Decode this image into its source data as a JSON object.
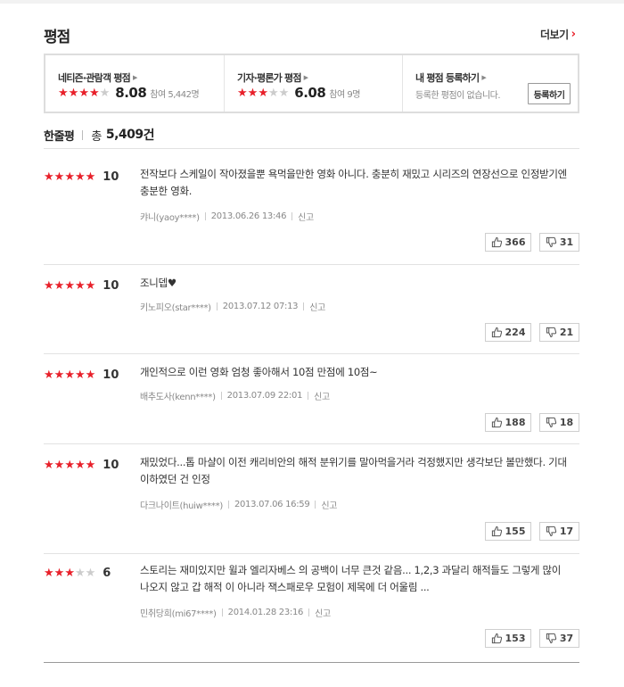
{
  "section": {
    "title": "평점",
    "more_label": "더보기"
  },
  "rating_box": {
    "netizen": {
      "label": "네티즌·관람객 평점",
      "stars": 4,
      "score": "8.08",
      "participants": "참여 5,442명"
    },
    "critic": {
      "label": "기자·평론가 평점",
      "stars": 3,
      "score": "6.08",
      "participants": "참여 9명"
    },
    "mine": {
      "label": "내 평점 등록하기",
      "empty_text": "등록한 평점이 없습니다.",
      "register_label": "등록하기"
    }
  },
  "oneline": {
    "title": "한줄평",
    "total_label": "총",
    "total_count": "5,409",
    "total_unit": "건"
  },
  "reviews": [
    {
      "stars": 5,
      "score": "10",
      "text": "전작보다 스케일이 작아졌을뿐 욕먹을만한 영화 아니다. 충분히 재밌고 시리즈의 연장선으로 인정받기엔 충분한 영화.",
      "author": "캬니(yaoy****)",
      "date": "2013.06.26 13:46",
      "report": "신고",
      "likes": "366",
      "dislikes": "31"
    },
    {
      "stars": 5,
      "score": "10",
      "text": "조니뎁♥",
      "author": "키노피오(star****)",
      "date": "2013.07.12 07:13",
      "report": "신고",
      "likes": "224",
      "dislikes": "21"
    },
    {
      "stars": 5,
      "score": "10",
      "text": "개인적으로 이런 영화 엄청 좋아해서 10점 만점에 10점~",
      "author": "배추도사(kenn****)",
      "date": "2013.07.09 22:01",
      "report": "신고",
      "likes": "188",
      "dislikes": "18"
    },
    {
      "stars": 5,
      "score": "10",
      "text": "재밌었다...톱 마샬이 이전 캐리비안의 해적 분위기를 말아먹을거라 걱정했지만 생각보단 볼만했다. 기대 이하였던 건 인정",
      "author": "다크나이트(huiw****)",
      "date": "2013.07.06 16:59",
      "report": "신고",
      "likes": "155",
      "dislikes": "17"
    },
    {
      "stars": 3,
      "score": "6",
      "text": "스토리는 재미있지만 윌과 엘리자베스 의 공백이 너무 큰것 같음... 1,2,3 과달리 해적들도 그렇게 많이 나오지 않고 갑 해적 이 아니라 잭스패로우 모험이 제목에 더 어울림 ...",
      "author": "민취당희(mi67****)",
      "date": "2014.01.28 23:16",
      "report": "신고",
      "likes": "153",
      "dislikes": "37"
    }
  ],
  "colors": {
    "accent": "#e8202a",
    "star_off": "#cccccc"
  }
}
